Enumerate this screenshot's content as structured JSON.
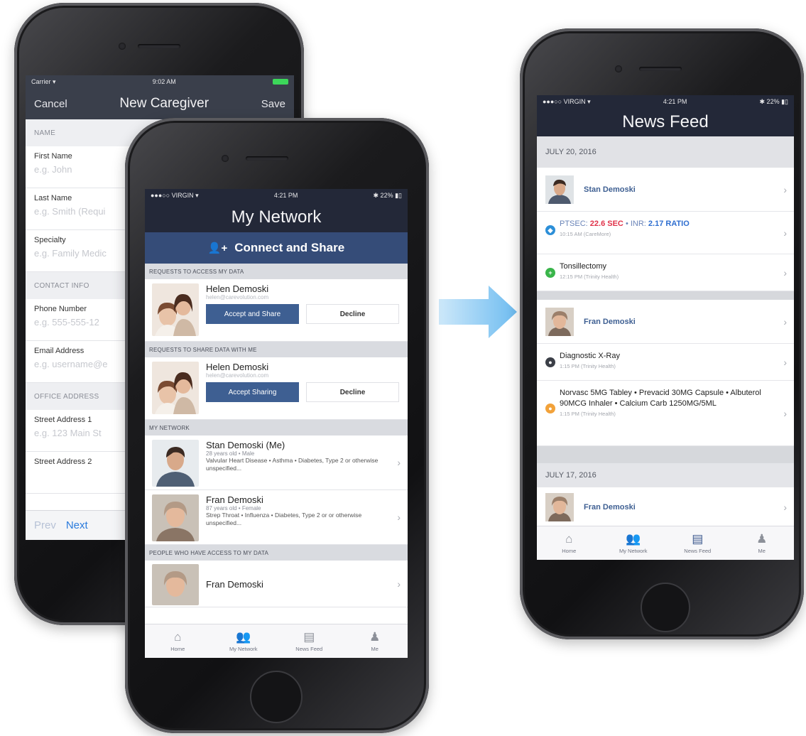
{
  "caregiver": {
    "status": {
      "carrier": "Carrier ▾",
      "time": "9:02 AM"
    },
    "nav": {
      "cancel": "Cancel",
      "title": "New Caregiver",
      "save": "Save"
    },
    "sections": [
      {
        "header": "NAME",
        "fields": [
          {
            "label": "First Name",
            "placeholder": "e.g. John"
          },
          {
            "label": "Last Name",
            "placeholder": "e.g. Smith (Requi"
          },
          {
            "label": "Specialty",
            "placeholder": "e.g. Family Medic"
          }
        ]
      },
      {
        "header": "CONTACT INFO",
        "fields": [
          {
            "label": "Phone Number",
            "placeholder": "e.g. 555-555-12"
          },
          {
            "label": "Email Address",
            "placeholder": "e.g. username@e"
          }
        ]
      },
      {
        "header": "OFFICE ADDRESS",
        "fields": [
          {
            "label": "Street Address 1",
            "placeholder": "e.g. 123 Main St"
          },
          {
            "label": "Street Address 2",
            "placeholder": ""
          }
        ]
      }
    ],
    "prev": "Prev",
    "next": "Next"
  },
  "network": {
    "status": {
      "carrier": "●●●○○ VIRGIN ▾",
      "time": "4:21 PM",
      "battery": "✱ 22% ▮▯"
    },
    "title": "My Network",
    "connect_label": "Connect and Share",
    "requests_access_header": "REQUESTS TO ACCESS MY DATA",
    "requests_share_header": "REQUESTS TO SHARE DATA WITH ME",
    "my_network_header": "MY NETWORK",
    "people_access_header": "PEOPLE WHO HAVE ACCESS TO MY DATA",
    "request_access": {
      "name": "Helen Demoski",
      "email": "helen@carevolution.com",
      "accept": "Accept and Share",
      "decline": "Decline"
    },
    "request_share": {
      "name": "Helen Demoski",
      "email": "helen@carevolution.com",
      "accept": "Accept Sharing",
      "decline": "Decline"
    },
    "members": [
      {
        "name": "Stan Demoski (Me)",
        "sub": "28 years old • Male",
        "conditions": "Valvular Heart Disease • Asthma • Diabetes, Type 2 or otherwise unspecified..."
      },
      {
        "name": "Fran Demoski",
        "sub": "87 years old • Female",
        "conditions": "Strep Throat • Influenza • Diabetes, Type 2 or or otherwise unspecified..."
      }
    ],
    "access_person": "Fran Demoski"
  },
  "feed": {
    "status": {
      "carrier": "●●●○○ VIRGIN ▾",
      "time": "4:21 PM",
      "battery": "✱ 22% ▮▯"
    },
    "title": "News Feed",
    "date1": "JULY 20, 2016",
    "date2": "JULY 17, 2016",
    "stan": "Stan Demoski",
    "lab": {
      "label": "PTSEC:",
      "sec": "22.6 SEC",
      "sep": " • INR: ",
      "ratio": "2.17 RATIO",
      "time": "10:15 AM (CareMore)"
    },
    "procedure": {
      "title": "Tonsillectomy",
      "time": "12:15 PM (Trinity Health)"
    },
    "fran": "Fran Demoski",
    "xray": {
      "title": "Diagnostic X-Ray",
      "time": "1:15 PM (Trinity Health)"
    },
    "meds": {
      "title": "Norvasc 5MG Tabley • Prevacid 30MG Capsule • Albuterol 90MCG Inhaler • Calcium Carb 1250MG/5ML",
      "time": "1:15 PM (Trinity Health)"
    },
    "fran2": "Fran Demoski"
  },
  "tabs": {
    "home": "Home",
    "network": "My Network",
    "feed": "News Feed",
    "me": "Me"
  },
  "colors": {
    "nav_dark": "#232838",
    "connect_blue": "#354c78",
    "accent_blue": "#3e5f92",
    "arrow": "#7ec3f0"
  }
}
